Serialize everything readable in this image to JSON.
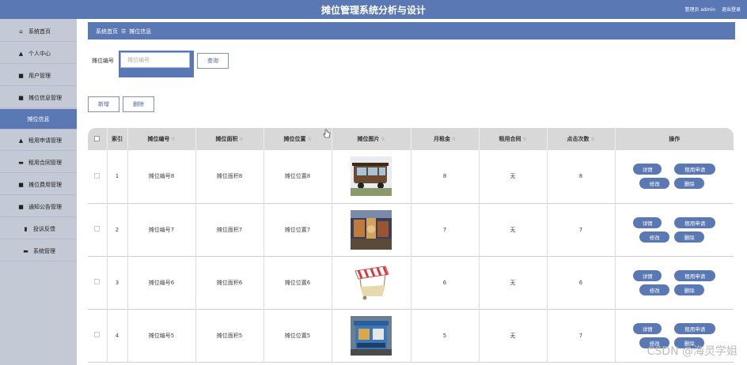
{
  "header": {
    "title": "摊位管理系统分析与设计",
    "user_label": "管理员 admin",
    "logout_label": "退出登录"
  },
  "sidebar": {
    "items": [
      {
        "icon": "⌂",
        "label": "系统首页"
      },
      {
        "icon": "▲",
        "label": "个人中心"
      },
      {
        "icon": "■",
        "label": "用户管理"
      },
      {
        "icon": "■",
        "label": "摊位信息管理"
      },
      {
        "icon": "",
        "label": "摊位信息"
      },
      {
        "icon": "▲",
        "label": "租用申请管理"
      },
      {
        "icon": "▬",
        "label": "租用合同管理"
      },
      {
        "icon": "■",
        "label": "摊位费用管理"
      },
      {
        "icon": "■",
        "label": "通知公告管理"
      },
      {
        "icon": "▮",
        "label": "投诉反馈"
      },
      {
        "icon": "▬",
        "label": "系统管理"
      }
    ]
  },
  "breadcrumb": {
    "home": "系统首页",
    "separator": "☰",
    "current": "摊位信息"
  },
  "search": {
    "label": "摊位编号",
    "placeholder": "摊位编号",
    "query_button": "查询"
  },
  "toolbar": {
    "add_label": "新增",
    "delete_label": "删除"
  },
  "table": {
    "columns": [
      "索引",
      "摊位编号",
      "摊位面积",
      "摊位位置",
      "摊位图片",
      "月租金",
      "租用合同",
      "点击次数",
      "操作"
    ],
    "rows": [
      {
        "index": "1",
        "code": "摊位编号8",
        "area": "摊位面积8",
        "location": "摊位位置8",
        "image": "food-cart",
        "rent": "8",
        "contract": "无",
        "clicks": "8"
      },
      {
        "index": "2",
        "code": "摊位编号7",
        "area": "摊位面积7",
        "location": "摊位位置7",
        "image": "market-stall",
        "rent": "7",
        "contract": "无",
        "clicks": "7"
      },
      {
        "index": "3",
        "code": "摊位编号6",
        "area": "摊位面积6",
        "location": "摊位位置6",
        "image": "striped-cart",
        "rent": "6",
        "contract": "无",
        "clicks": "6"
      },
      {
        "index": "4",
        "code": "摊位编号5",
        "area": "摊位面积5",
        "location": "摊位位置5",
        "image": "blue-kiosk",
        "rent": "5",
        "contract": "无",
        "clicks": "7"
      }
    ],
    "actions": {
      "detail": "详情",
      "apply": "租用申请",
      "edit": "修改",
      "delete": "删除"
    }
  },
  "watermark": "CSDN @海灵学姐",
  "colors": {
    "primary": "#5a78b4",
    "sidebar": "#c4c9d6",
    "header_row": "#d8d8d8"
  }
}
